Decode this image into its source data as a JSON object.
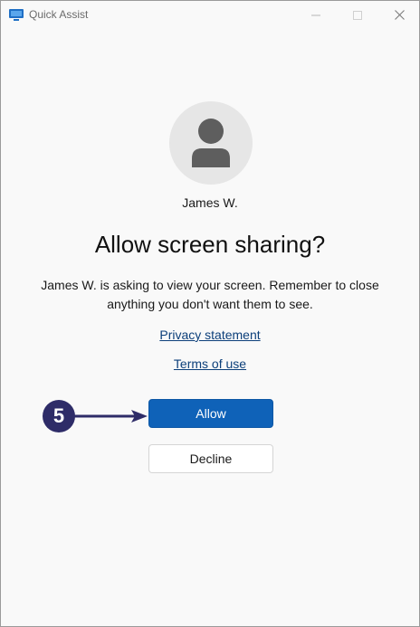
{
  "window": {
    "title": "Quick Assist"
  },
  "user": {
    "name": "James W."
  },
  "prompt": {
    "headline": "Allow screen sharing?",
    "message": "James W. is asking to view your screen. Remember to close anything you don't want them to see."
  },
  "links": {
    "privacy": "Privacy statement",
    "terms": "Terms of use"
  },
  "buttons": {
    "allow": "Allow",
    "decline": "Decline"
  },
  "annotation": {
    "step_number": "5"
  },
  "colors": {
    "accent": "#0f62b8",
    "annotation": "#2e2c68",
    "avatar_bg": "#e6e6e6",
    "avatar_fg": "#5e5e5e"
  },
  "icons": {
    "app": "quick-assist-monitor-icon",
    "avatar": "person-icon",
    "minimize": "minimize-icon",
    "maximize": "maximize-icon",
    "close": "close-icon"
  }
}
